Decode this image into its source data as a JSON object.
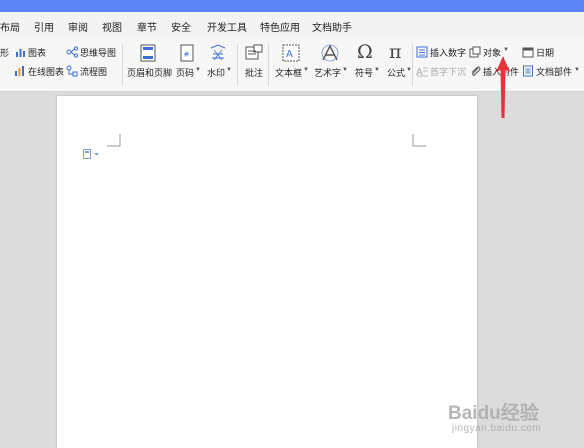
{
  "menu": [
    "布局",
    "引用",
    "审阅",
    "视图",
    "章节",
    "安全",
    "开发工具",
    "特色应用",
    "文档助手"
  ],
  "ribbon": {
    "cut_shape": "形",
    "chart": "图表",
    "mind_map": "思维导图",
    "online_chart": "在线图表",
    "flowchart": "流程图",
    "header_footer": "页眉和页脚",
    "page_number": "页码",
    "watermark": "水印",
    "comment": "批注",
    "textbox": "文本框",
    "wordart": "艺术字",
    "symbol": "符号",
    "formula": "公式",
    "insert_number": "插入数字",
    "first_letter_sink": "首字下沉",
    "object": "对象",
    "insert_attachment": "插入附件",
    "date": "日期",
    "doc_parts": "文档部件"
  },
  "watermark": {
    "brand": "Baidu经验",
    "url": "jingyan.baidu.com"
  },
  "colors": {
    "titlebar": "#5b84f6",
    "arrow": "#e8333b",
    "icon_blue": "#3b6fd8"
  }
}
